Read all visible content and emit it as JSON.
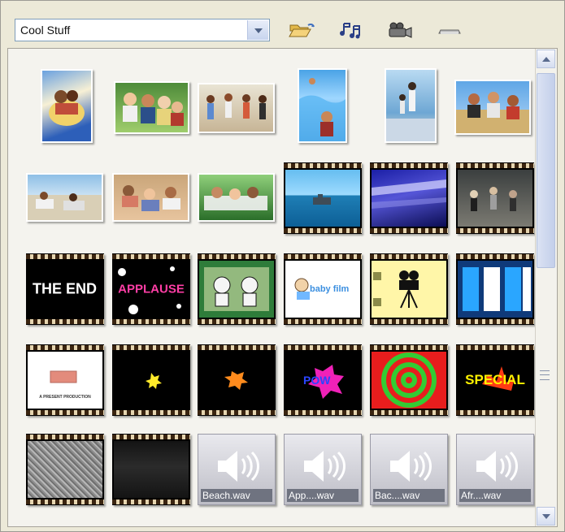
{
  "window": {
    "collection_select": {
      "value": "Cool Stuff"
    },
    "toolbar_icons": [
      "open-folder-icon",
      "music-notes-icon",
      "camera-icon",
      "slider-icon"
    ]
  },
  "library": {
    "items": [
      {
        "type": "photo",
        "name": "photo-1"
      },
      {
        "type": "photo",
        "name": "photo-2"
      },
      {
        "type": "photo",
        "name": "photo-3"
      },
      {
        "type": "photo",
        "name": "photo-4"
      },
      {
        "type": "photo",
        "name": "photo-5"
      },
      {
        "type": "photo",
        "name": "photo-6"
      },
      {
        "type": "photo",
        "name": "photo-7"
      },
      {
        "type": "photo",
        "name": "photo-8"
      },
      {
        "type": "photo",
        "name": "photo-9"
      },
      {
        "type": "video",
        "name": "video-1"
      },
      {
        "type": "video",
        "name": "video-2"
      },
      {
        "type": "video",
        "name": "video-3"
      },
      {
        "type": "video",
        "name": "video-the-end",
        "text": "THE END"
      },
      {
        "type": "video",
        "name": "video-applause",
        "text": "APPLAUSE"
      },
      {
        "type": "video",
        "name": "video-cartoon"
      },
      {
        "type": "video",
        "name": "video-baby",
        "text": "baby film"
      },
      {
        "type": "video",
        "name": "video-camera"
      },
      {
        "type": "video",
        "name": "video-blue"
      },
      {
        "type": "video",
        "name": "video-production",
        "text": "A PRESENT PRODUCTION"
      },
      {
        "type": "video",
        "name": "video-burst-1"
      },
      {
        "type": "video",
        "name": "video-burst-2"
      },
      {
        "type": "video",
        "name": "video-pow",
        "text": "POW"
      },
      {
        "type": "video",
        "name": "video-spiral"
      },
      {
        "type": "video",
        "name": "video-special",
        "text": "SPECIAL"
      },
      {
        "type": "video",
        "name": "video-static"
      },
      {
        "type": "video",
        "name": "video-dark"
      },
      {
        "type": "audio",
        "name": "audio-beach",
        "label": "Beach.wav"
      },
      {
        "type": "audio",
        "name": "audio-app",
        "label": "App....wav"
      },
      {
        "type": "audio",
        "name": "audio-bac",
        "label": "Bac....wav"
      },
      {
        "type": "audio",
        "name": "audio-afr",
        "label": "Afr....wav"
      }
    ]
  }
}
